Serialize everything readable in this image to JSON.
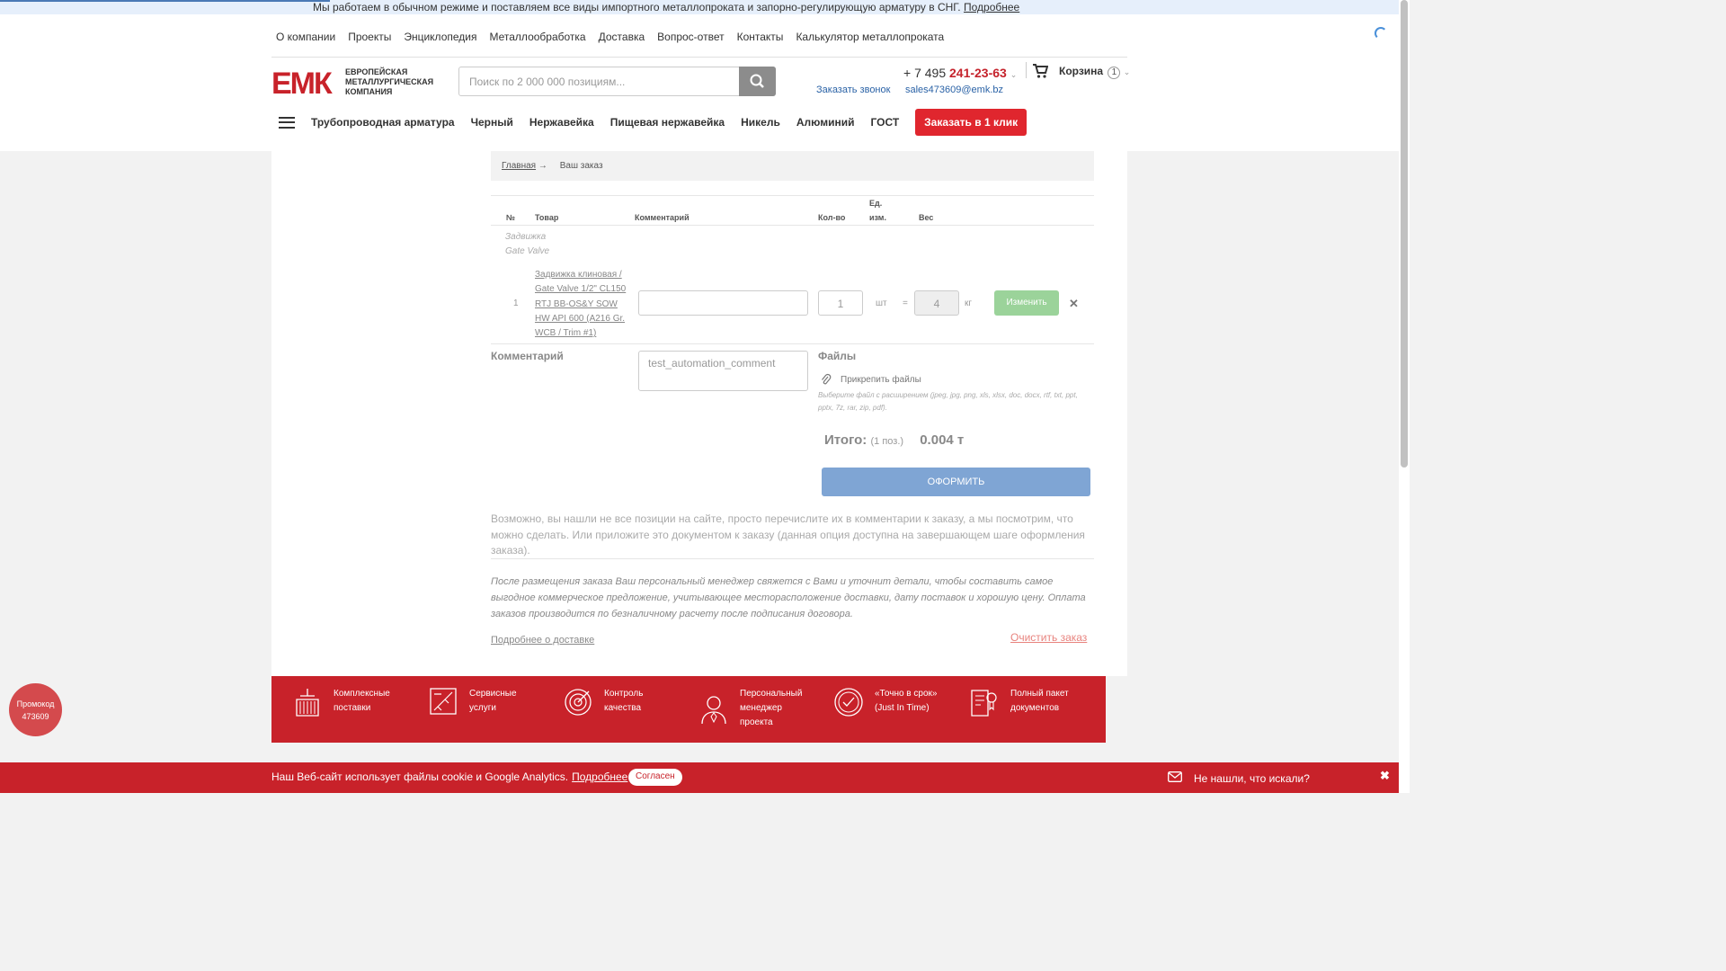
{
  "topbar": {
    "message": "Мы работаем в обычном режиме и поставляем все виды импортного металлопроката и запорно-регулирующую арматуру в СНГ.",
    "more": "Подробнее"
  },
  "topnav": [
    "О компании",
    "Проекты",
    "Энциклопедия",
    "Металлообработка",
    "Доставка",
    "Вопрос-ответ",
    "Контакты",
    "Калькулятор металлопроката"
  ],
  "logo": {
    "line1": "ЕВРОПЕЙСКАЯ",
    "line2": "МЕТАЛЛУРГИЧЕСКАЯ",
    "line3": "КОМПАНИЯ",
    "mark": "ЕМК"
  },
  "search": {
    "placeholder": "Поиск по 2 000 000 позициям..."
  },
  "contacts": {
    "phone_prefix": "+ 7 495 ",
    "phone_main": "241-23-63",
    "callback": "Заказать звонок",
    "email": "sales473609@emk.bz"
  },
  "cart": {
    "label": "Корзина",
    "count": "1"
  },
  "catnav": [
    "Трубопроводная арматура",
    "Черный",
    "Нержавейка",
    "Пищевая нержавейка",
    "Никель",
    "Алюминий",
    "ГОСТ"
  ],
  "order_one_click": "Заказать в 1 клик",
  "breadcrumb": {
    "home": "Главная",
    "arrow": "→",
    "current": "Ваш заказ"
  },
  "table": {
    "headers": {
      "num": "№",
      "product": "Товар",
      "comment": "Комментарий",
      "qty": "Кол-во",
      "unit1": "Ед.",
      "unit2": "изм.",
      "weight": "Вес"
    },
    "group_ru": "Задвижка",
    "group_en": "Gate Valve",
    "row": {
      "num": "1",
      "product": "Задвижка клиновая / Gate Valve 1/2\" CL150 RTJ BB-OS&Y SOW HW API 600 (A216 Gr. WCB / Trim #1)",
      "qty": "1",
      "unit": "шт",
      "eq": "=",
      "weight": "4",
      "weight_unit": "кг",
      "change": "Изменить",
      "delete": "✕"
    }
  },
  "comment": {
    "label": "Комментарий",
    "value": "test_automation_comment"
  },
  "files": {
    "label": "Файлы",
    "attach": "Прикрепить файлы",
    "hint": "Выберите файл с расширением (jpeg, jpg, png, xls, xlsx, doc, docx, rtf, txt, ppt, pptx, 7z, rar, zip, pdf)."
  },
  "total": {
    "label": "Итого:",
    "positions": "(1 поз.)",
    "value": "0.004 т"
  },
  "checkout": "ОФОРМИТЬ",
  "note1": "Возможно, вы нашли не все позиции на сайте, просто перечислите их в комментарии к заказу, а мы посмотрим, что можно сделать. Или приложите это документом к заказу (данная опция доступна на завершающем шаге оформления заказа).",
  "note2": "После размещения заказа Ваш персональный менеджер свяжется с Вами и уточнит детали, чтобы составить самое выгодное коммерческое предложение, учитывающее месторасположение доставки, дату поставок и хорошую цену. Оплата заказов производится по безналичному расчету после подписания договора.",
  "delivery_link": "Подробнее о доставке",
  "clear_order": "Очистить заказ",
  "features": [
    "Комплексные поставки",
    "Сервисные услуги",
    "Контроль качества",
    "Персональный менеджер проекта",
    "«Точно в срок» (Just In Time)",
    "Полный пакет документов"
  ],
  "promo": {
    "line1": "Промокод",
    "line2": "473609"
  },
  "cookie": {
    "text": "Наш Веб-сайт использует файлы cookie и Google Analytics.",
    "more": "Подробнее",
    "agree": "Согласен"
  },
  "chat": {
    "title": "Не нашли, что искали?",
    "close": "✖"
  },
  "colors": {
    "brand_red": "#c8222a",
    "link_blue": "#2a62a6",
    "checkout_blue": "#7fa5d4",
    "change_green": "#9bd39a"
  }
}
